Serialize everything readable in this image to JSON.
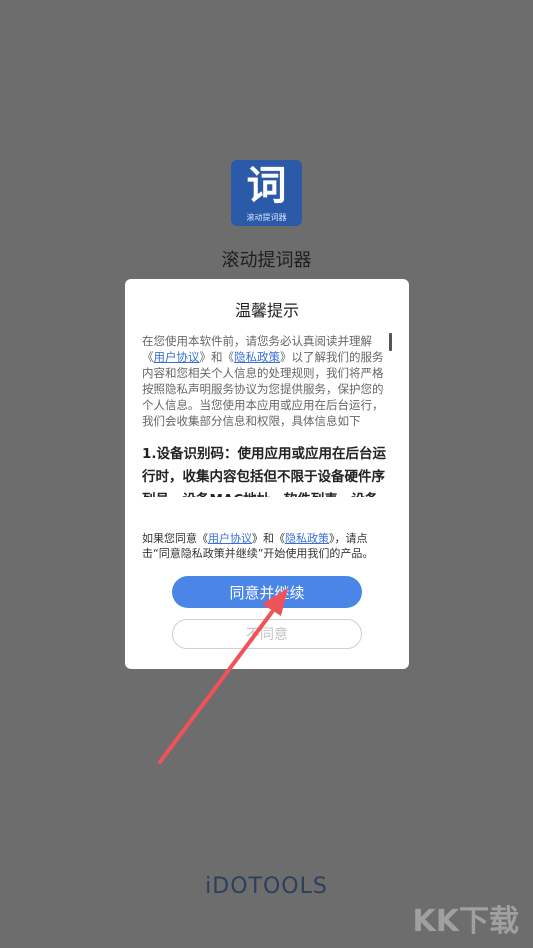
{
  "app": {
    "icon_glyph": "词",
    "icon_caption": "滚动提词器",
    "name": "滚动提词器"
  },
  "dialog": {
    "title": "温馨提示",
    "intro_1": "在您使用本软件前，请您务必认真阅读并理解",
    "intro_link_open_1": "《",
    "user_agreement": "用户协议",
    "intro_link_close_1": "》",
    "intro_and": "和",
    "intro_link_open_2": "《",
    "privacy_policy": "隐私政策",
    "intro_link_close_2": "》",
    "intro_2": "以了解我们的服务内容和您相关个人信息的处理规则，我们将严格按照隐私声明服务协议为您提供服务，保护您的个人信息。当您使用本应用或应用在后台运行，我们会收集部分信息和权限，具体信息如下",
    "section_1": "1.设备识别码：使用应用或应用在后台运行时，收集内容包括但不限于设备硬件序列号、设备MAC地址、软件列表、设备",
    "consent_1": "如果您同意",
    "consent_user_agreement": "用户协议",
    "consent_and": "和",
    "consent_privacy_policy": "隐私政策",
    "consent_2": "，请点击“同意隐私政策并继续”开始使用我们的产品。",
    "agree_label": "同意并继续",
    "disagree_label": "不同意"
  },
  "footer": {
    "brand": "iDOTOOLS",
    "watermark": "KK下载"
  },
  "colors": {
    "overlay": "#6d6d6d",
    "accent": "#4a86e8",
    "link": "#3a6fd8",
    "icon_bg": "#2b5aa8",
    "arrow": "#f0525a"
  }
}
